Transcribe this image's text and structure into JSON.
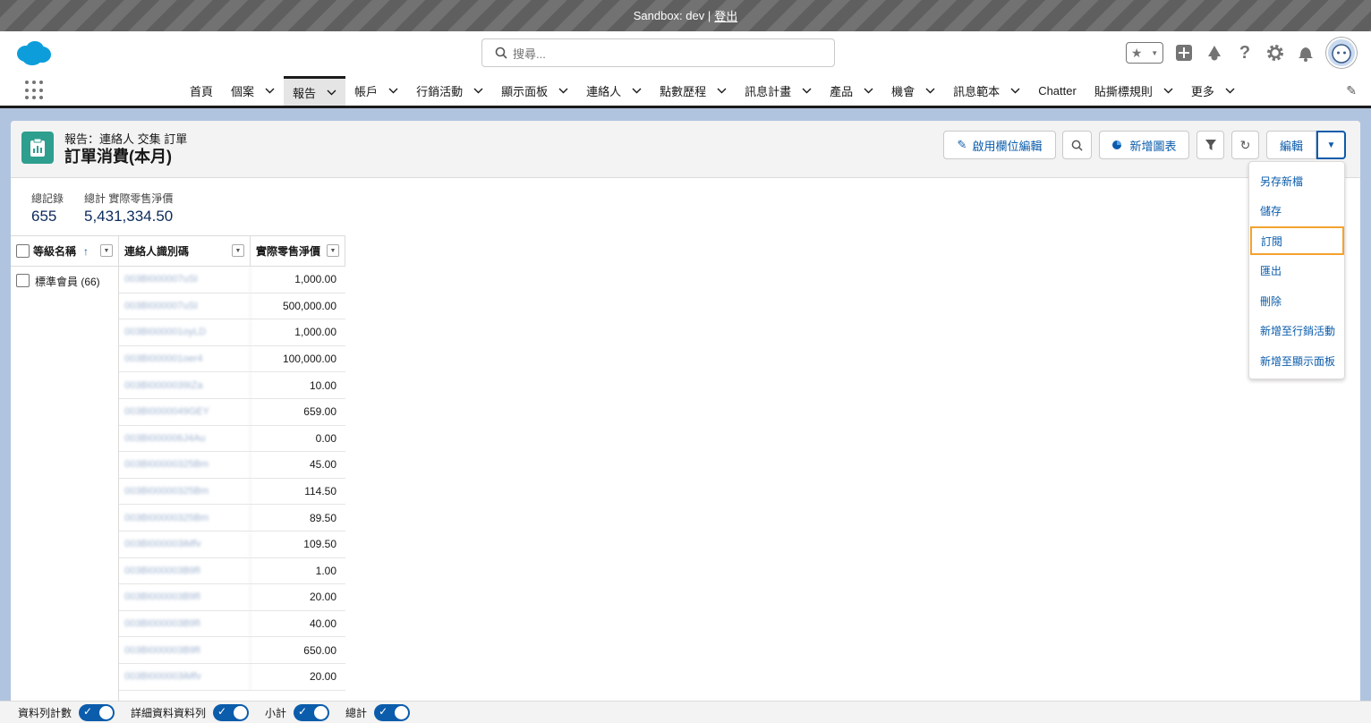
{
  "sandbox": {
    "label": "Sandbox: dev |",
    "logout": "登出"
  },
  "header": {
    "search_placeholder": "搜尋..."
  },
  "nav": {
    "items": [
      {
        "label": "首頁",
        "chevron": false
      },
      {
        "label": "個案",
        "chevron": true
      },
      {
        "label": "報告",
        "chevron": true,
        "active": true
      },
      {
        "label": "帳戶",
        "chevron": true
      },
      {
        "label": "行銷活動",
        "chevron": true
      },
      {
        "label": "顯示面板",
        "chevron": true
      },
      {
        "label": "連絡人",
        "chevron": true
      },
      {
        "label": "點數歷程",
        "chevron": true
      },
      {
        "label": "訊息計畫",
        "chevron": true
      },
      {
        "label": "產品",
        "chevron": true
      },
      {
        "label": "機會",
        "chevron": true
      },
      {
        "label": "訊息範本",
        "chevron": true
      },
      {
        "label": "Chatter",
        "chevron": false
      },
      {
        "label": "貼撕標規則",
        "chevron": true
      },
      {
        "label": "更多",
        "chevron": true
      }
    ]
  },
  "report": {
    "breadcrumb": "報告：連絡人 交集 訂單",
    "title": "訂單消費(本月)"
  },
  "buttons": {
    "inline_edit": "啟用欄位編輯",
    "add_chart": "新增圖表",
    "edit": "編輯"
  },
  "summary": {
    "total_records_label": "總記錄",
    "total_records": "655",
    "total_net_label": "總計 實際零售淨價",
    "total_net": "5,431,334.50"
  },
  "table": {
    "headers": [
      "等級名稱",
      "連絡人識別碼",
      "實際零售淨價"
    ],
    "sort_arrow": "↑",
    "group_label": "標準會員 (66)",
    "rows": [
      {
        "id": "003BI000007uSI",
        "value": "1,000.00"
      },
      {
        "id": "003BI000007uSI",
        "value": "500,000.00"
      },
      {
        "id": "003BI000001oyLD",
        "value": "1,000.00"
      },
      {
        "id": "003BI000001oer4",
        "value": "100,000.00"
      },
      {
        "id": "003BI0000039IZa",
        "value": "10.00"
      },
      {
        "id": "003BI0000049GEY",
        "value": "659.00"
      },
      {
        "id": "003BI000006J4Au",
        "value": "0.00"
      },
      {
        "id": "003BI00000325Bm",
        "value": "45.00"
      },
      {
        "id": "003BI00000325Bm",
        "value": "114.50"
      },
      {
        "id": "003BI00000325Bm",
        "value": "89.50"
      },
      {
        "id": "003BI000003iMfv",
        "value": "109.50"
      },
      {
        "id": "003BI000003B9fI",
        "value": "1.00"
      },
      {
        "id": "003BI000003B9fI",
        "value": "20.00"
      },
      {
        "id": "003BI000003B9fI",
        "value": "40.00"
      },
      {
        "id": "003BI000003B9fI",
        "value": "650.00"
      },
      {
        "id": "003BI000003iMfv",
        "value": "20.00"
      }
    ]
  },
  "menu": {
    "items": [
      "另存新檔",
      "儲存",
      "訂閱",
      "匯出",
      "刪除",
      "新增至行銷活動",
      "新增至顯示面板"
    ],
    "highlighted": "訂閱"
  },
  "footer": {
    "toggles": [
      "資料列計數",
      "詳細資料資料列",
      "小計",
      "總計"
    ]
  },
  "colors": {
    "accent": "#0b5cab",
    "highlight": "#f3a22e",
    "report_icon": "#2e9e8f"
  }
}
